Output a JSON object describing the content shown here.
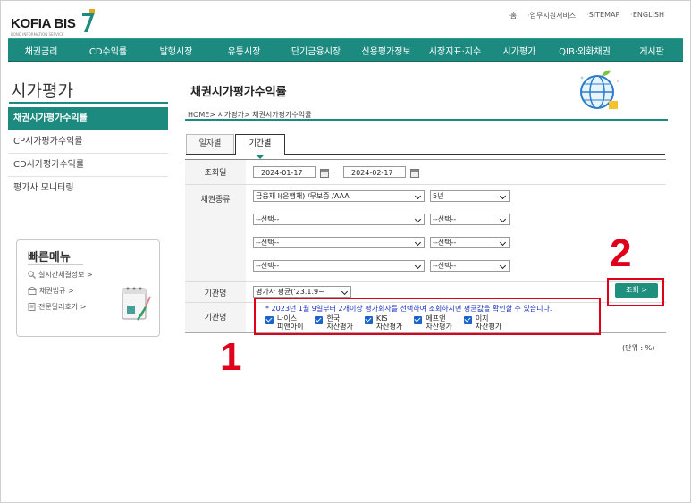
{
  "header": {
    "logo": "KOFIA BIS",
    "logo_sub": "BOND INFORMATION SERVICE",
    "top_links": [
      "홈",
      "업무지원서비스",
      "SITEMAP",
      "ENGLISH"
    ]
  },
  "gnb": {
    "items": [
      "채권금리",
      "CD수익률",
      "발행시장",
      "유통시장",
      "단기금융시장",
      "신용평가정보",
      "시장지표·지수",
      "시가평가",
      "QIB·외화채권",
      "게시판"
    ]
  },
  "sidebar": {
    "title": "시가평가",
    "items": [
      "채권시가평가수익률",
      "CP시가평가수익률",
      "CD시가평가수익률",
      "평가사 모니터링"
    ],
    "active_index": 0,
    "quick_menu": {
      "title": "빠른메뉴",
      "items": [
        "실시간체결정보 >",
        "채권법규 >",
        "전문딜러호가 >"
      ]
    }
  },
  "main": {
    "title": "채권시가평가수익률",
    "breadcrumb": "HOME> 시가평가> 채권시가평가수익률",
    "tabs": [
      "일자별",
      "기간별"
    ],
    "active_tab": 1,
    "form": {
      "date_label": "조회일",
      "date_from": "2024-01-17",
      "date_sep": "~",
      "date_to": "2024-02-17",
      "bond_type_label": "채권종류",
      "bond_rows": [
        {
          "type": "금융채 I(은행채) /무보증 /AAA",
          "term": "5년"
        },
        {
          "type": "--선택--",
          "term": "--선택--"
        },
        {
          "type": "--선택--",
          "term": "--선택--"
        },
        {
          "type": "--선택--",
          "term": "--선택--"
        }
      ],
      "agency_label": "기관명",
      "agency_select": "평가사 평균('23.1.9~",
      "agency_label2": "기관명",
      "search_button": "조회 >",
      "note": "* 2023년 1월 9일부터 2개이상 평가회사를 선택하여 조회하시면 평균값을 확인할 수 있습니다.",
      "agencies": [
        {
          "line1": "나이스",
          "line2": "피앤아이",
          "checked": true
        },
        {
          "line1": "한국",
          "line2": "자산평가",
          "checked": true
        },
        {
          "line1": "KIS",
          "line2": "자산평가",
          "checked": true
        },
        {
          "line1": "에프앤",
          "line2": "자산평가",
          "checked": true
        },
        {
          "line1": "이지",
          "line2": "자산평가",
          "checked": true
        }
      ]
    },
    "unit": "(단위 : %)"
  },
  "annotations": {
    "label1": "1",
    "label2": "2",
    "color": "#e0001b"
  },
  "colors": {
    "accent": "#1d8a80",
    "checkbox": "#1a63c8"
  }
}
